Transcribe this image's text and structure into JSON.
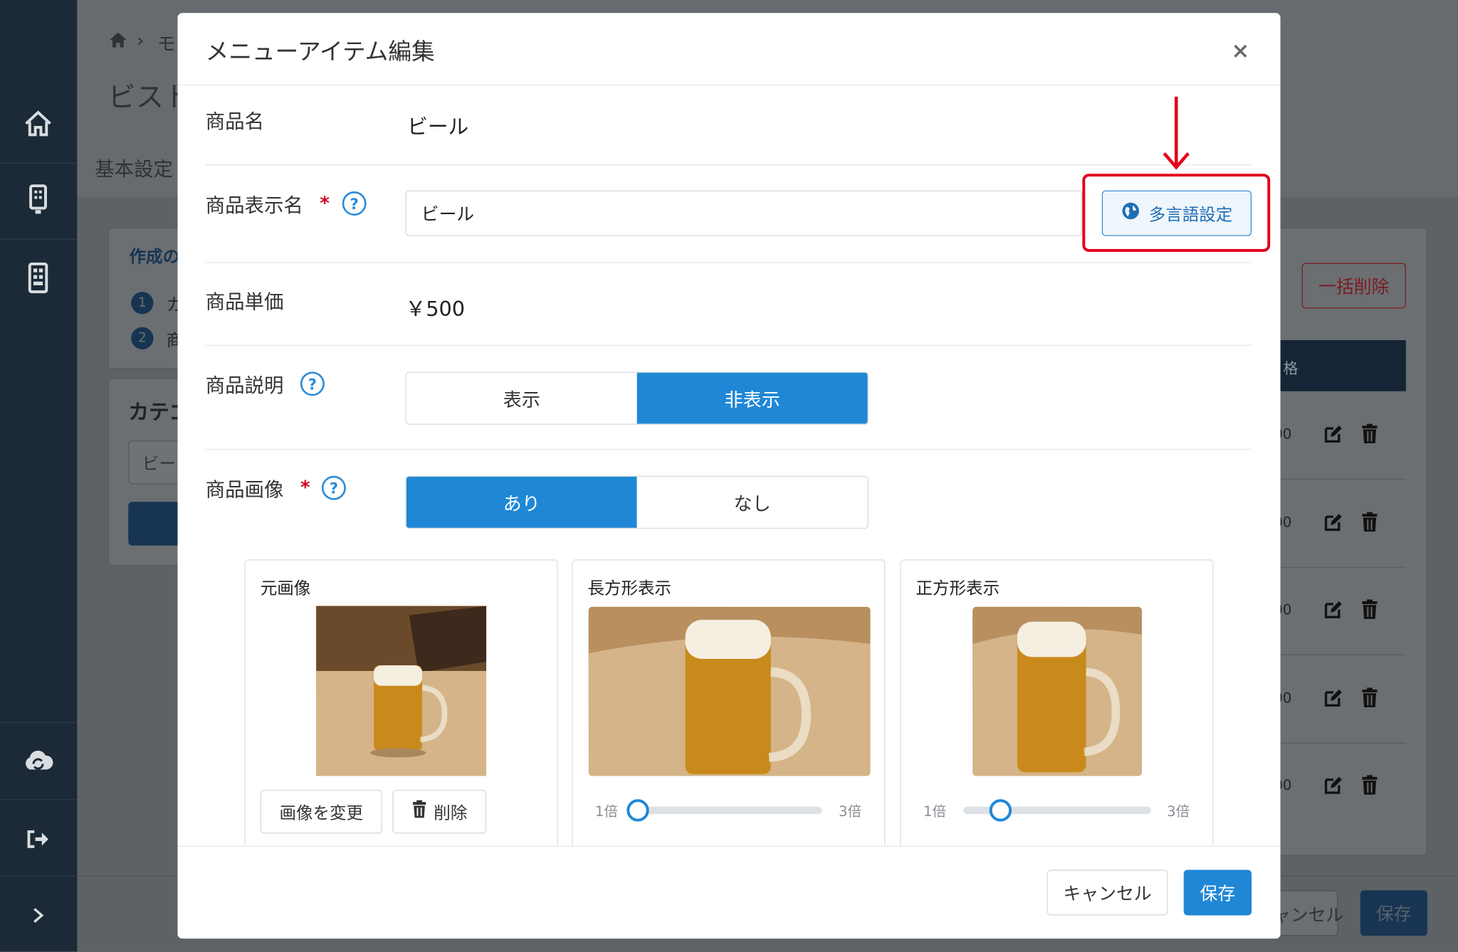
{
  "background": {
    "breadcrumb_text": "モ",
    "page_title": "ビスト",
    "tab_basic": "基本設定",
    "guide_title": "作成の",
    "guide_step1": "カ",
    "guide_step2": "商",
    "guide_num1": "1",
    "guide_num2": "2",
    "category_title": "カテゴ",
    "category_input": "ビー",
    "bulk_delete": "一括削除",
    "table_header": "格",
    "row_value": "00",
    "bottom_cancel": "ャンセル",
    "bottom_save": "保存"
  },
  "modal": {
    "title": "メニューアイテム編集",
    "product_name_label": "商品名",
    "product_name_value": "ビール",
    "display_name_label": "商品表示名",
    "required_mark": "*",
    "help_mark": "?",
    "display_name_value": "ビール",
    "multilang_button": "多言語設定",
    "price_label": "商品単価",
    "price_value": "￥500",
    "description_label": "商品説明",
    "description_options": [
      "表示",
      "非表示"
    ],
    "description_selected": "非表示",
    "image_label": "商品画像",
    "image_options": [
      "あり",
      "なし"
    ],
    "image_selected": "あり",
    "cards": {
      "original": {
        "title": "元画像",
        "change_button": "画像を変更",
        "delete_button": "削除"
      },
      "rect": {
        "title": "長方形表示",
        "min_label": "1倍",
        "max_label": "3倍",
        "zoom_level": 0.0
      },
      "square": {
        "title": "正方形表示",
        "min_label": "1倍",
        "max_label": "3倍",
        "zoom_level": 0.2
      }
    },
    "cancel_button": "キャンセル",
    "save_button": "保存"
  },
  "colors": {
    "accent": "#1f87d6",
    "highlight": "#e3001b",
    "sidebar": "#1b2a36"
  }
}
